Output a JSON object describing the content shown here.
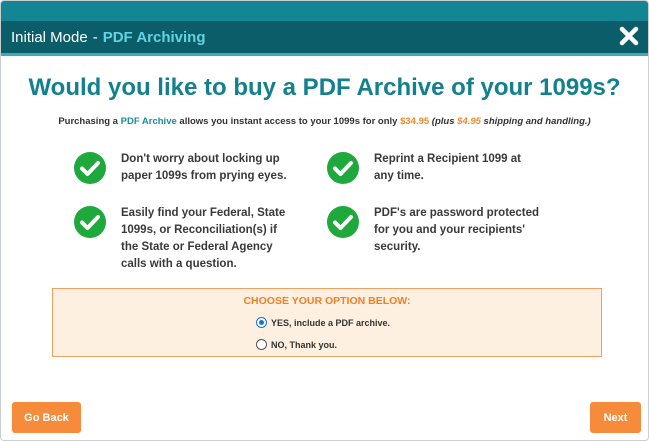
{
  "header": {
    "title": "Initial Mode",
    "separator": "-",
    "subtitle": "PDF Archiving",
    "close_icon": "close-x-icon"
  },
  "headline": "Would you like to buy a PDF Archive of your 1099s?",
  "subline": {
    "part1": "Purchasing a ",
    "accent": "PDF Archive",
    "part2": " allows you instant access to your 1099s for only ",
    "price": "$34.95",
    "ship_open": " (plus ",
    "ship_price": "$4.95",
    "ship_close": " shipping and handling.)"
  },
  "features": [
    {
      "icon": "check-circle-icon",
      "text": "Don't worry about locking up paper 1099s from prying eyes."
    },
    {
      "icon": "check-circle-icon",
      "text": "Reprint a Recipient 1099 at any time."
    },
    {
      "icon": "check-circle-icon",
      "text": "Easily find your Federal, State 1099s, or Reconciliation(s) if the State or Federal Agency calls with a question."
    },
    {
      "icon": "check-circle-icon",
      "text": "PDF's are password protected for you and your recipients' security."
    }
  ],
  "options": {
    "title": "CHOOSE YOUR OPTION BELOW:",
    "items": [
      {
        "label": "YES, include a PDF archive.",
        "selected": true
      },
      {
        "label": "NO, Thank you.",
        "selected": false
      }
    ]
  },
  "buttons": {
    "back": "Go Back",
    "next": "Next"
  },
  "colors": {
    "header_dark": "#0b5e69",
    "header_stripe": "#128693",
    "accent_teal": "#13808e",
    "check_green": "#1fa83b",
    "orange": "#f58b3b",
    "options_bg": "#fdf0e1"
  }
}
